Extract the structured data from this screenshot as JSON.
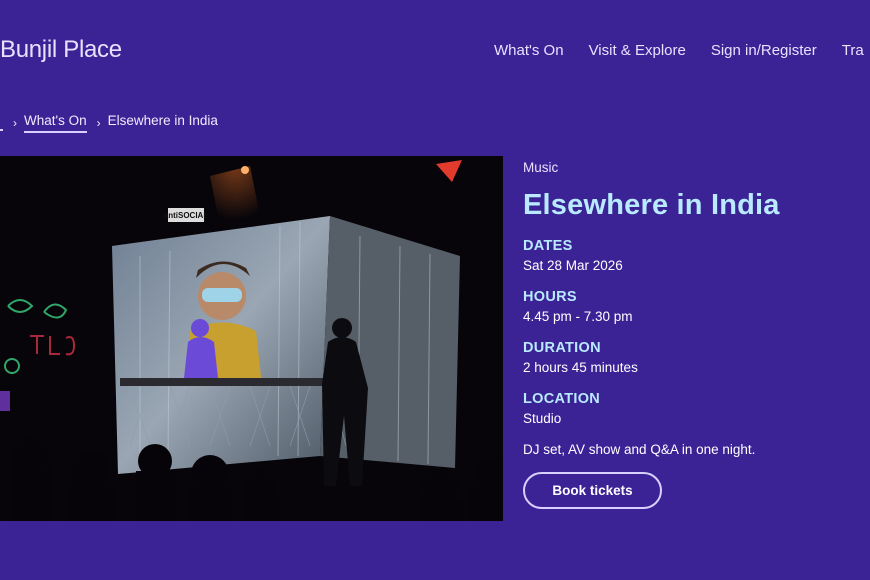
{
  "header": {
    "logo": "Bunjil Place",
    "nav": [
      "What's On",
      "Visit & Explore",
      "Sign in/Register",
      "Tra"
    ]
  },
  "breadcrumb": {
    "link": "What's On",
    "current": "Elsewhere in India"
  },
  "hero": {
    "sign_text": "antiSOCIAL"
  },
  "event": {
    "category": "Music",
    "title": "Elsewhere in India",
    "details": [
      {
        "heading": "DATES",
        "value": "Sat 28 Mar 2026"
      },
      {
        "heading": "HOURS",
        "value": "4.45 pm - 7.30 pm"
      },
      {
        "heading": "DURATION",
        "value": "2 hours 45 minutes"
      },
      {
        "heading": "LOCATION",
        "value": "Studio"
      }
    ],
    "description": "DJ set, AV show and Q&A in one night.",
    "cta": "Book tickets"
  },
  "colors": {
    "background": "#3b2396",
    "accent": "#b9eaff"
  }
}
